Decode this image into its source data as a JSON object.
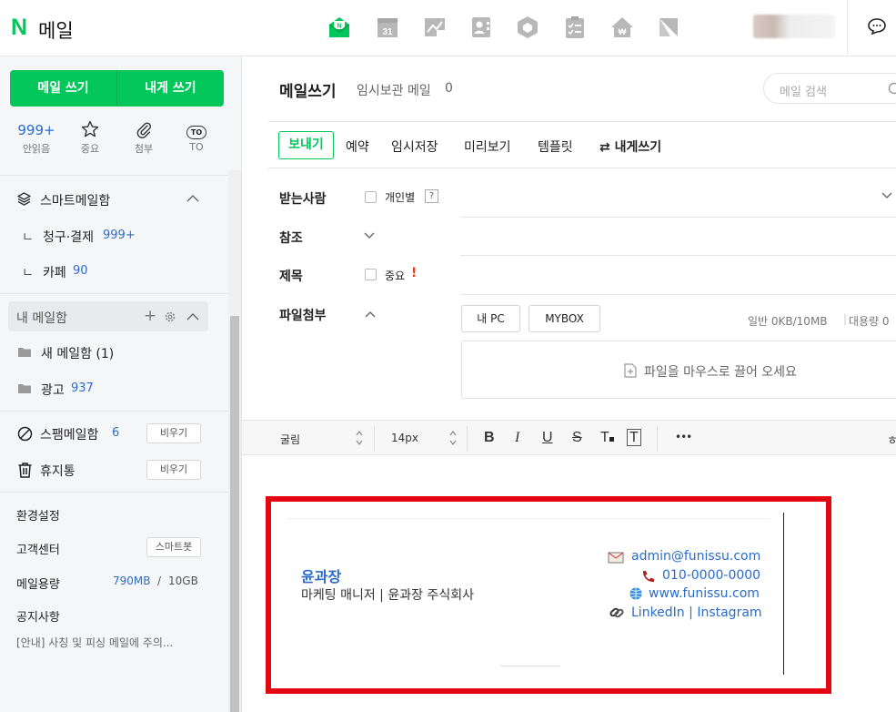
{
  "header": {
    "logo_n": "N",
    "logo_text": "메일",
    "calendar_day": "31",
    "apps": [
      "mail-app-icon",
      "calendar-app-icon",
      "memo-app-icon",
      "contacts-app-icon",
      "mybox-app-icon",
      "todo-app-icon",
      "home-app-icon",
      "shortcut-app-icon"
    ]
  },
  "sidebar": {
    "compose_label": "메일 쓰기",
    "self_compose_label": "내게 쓰기",
    "quick": [
      {
        "value": "999+",
        "label": "안읽음"
      },
      {
        "label": "중요"
      },
      {
        "label": "첨부"
      },
      {
        "badge": "TO",
        "label": "TO"
      }
    ],
    "smart_box": "스마트메일함",
    "smart_items": [
      {
        "prefix": "ㄴ",
        "label": "청구·결제",
        "count": "999+"
      },
      {
        "prefix": "ㄴ",
        "label": "카페",
        "count": "90"
      }
    ],
    "my_box": "내 메일함",
    "folders": [
      {
        "label": "새 메일함 (1)",
        "count": ""
      },
      {
        "label": "광고",
        "count": "937"
      }
    ],
    "spam": {
      "label": "스팸메일함",
      "count": "6",
      "button": "비우기"
    },
    "trash": {
      "label": "휴지통",
      "button": "비우기"
    },
    "settings": "환경설정",
    "support": {
      "label": "고객센터",
      "button": "스마트봇"
    },
    "storage": {
      "label": "메일용량",
      "used": "790MB",
      "sep": "/",
      "total": "10GB"
    },
    "notice_title": "공지사항",
    "notice_text": "[안내] 사칭 및 피싱 메일에 주의..."
  },
  "main": {
    "title": "메일쓰기",
    "draft_label": "임시보관 메일",
    "draft_count": "0",
    "search_placeholder": "메일 검색",
    "toolbar": {
      "send": "보내기",
      "reserve": "예약",
      "save": "임시저장",
      "preview": "미리보기",
      "template": "템플릿",
      "self": "⇄ 내게쓰기"
    },
    "fields": {
      "to": "받는사람",
      "individual": "개인별",
      "help": "?",
      "cc": "참조",
      "subject": "제목",
      "important": "중요",
      "important_mark": "!",
      "attach": "파일첨부",
      "my_pc": "내 PC",
      "mybox": "MYBOX",
      "capacity": "일반 0KB/10MB",
      "capacity_sep": "|",
      "large": "대용량 0",
      "drop_hint": "파일을 마우스로 끌어 오세요"
    },
    "editor": {
      "font": "굴림",
      "size": "14px",
      "more": "•••",
      "right_char": "ㅎ"
    }
  },
  "signature": {
    "name": "윤과장",
    "title": "마케팅 매니저 | 윤과장 주식회사",
    "email": "admin@funissu.com",
    "phone": "010-0000-0000",
    "website": "www.funissu.com",
    "linkedin": "LinkedIn",
    "link_sep": "|",
    "instagram": "Instagram"
  },
  "colors": {
    "brand": "#03c75a",
    "link": "#2b6bc9",
    "highlight": "#e30613"
  }
}
